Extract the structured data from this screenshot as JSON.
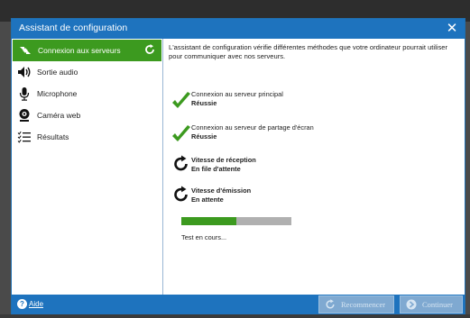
{
  "window": {
    "title": "Assistant de configuration"
  },
  "sidebar": {
    "items": [
      {
        "label": "Connexion aux serveurs",
        "icon": "server-connection-icon",
        "active": true
      },
      {
        "label": "Sortie audio",
        "icon": "speaker-icon"
      },
      {
        "label": "Microphone",
        "icon": "microphone-icon"
      },
      {
        "label": "Caméra web",
        "icon": "webcam-icon"
      },
      {
        "label": "Résultats",
        "icon": "results-list-icon"
      }
    ]
  },
  "main": {
    "intro": "L'assistant de configuration vérifie différentes méthodes que votre ordinateur pourrait utiliser pour communiquer avec nos serveurs.",
    "checks": [
      {
        "name": "Connexion au serveur principal",
        "status": "Réussie",
        "icon": "checkmark-icon"
      },
      {
        "name": "Connexion au serveur de partage d'écran",
        "status": "Réussie",
        "icon": "checkmark-icon"
      },
      {
        "name": "Vitesse de réception",
        "status": "En file d'attente",
        "icon": "refresh-icon"
      },
      {
        "name": "Vitesse d'émission",
        "status": "En attente",
        "icon": "refresh-icon"
      }
    ],
    "progress_fraction": 0.5,
    "progress_text": "Test en cours..."
  },
  "footer": {
    "help_label": "Aide",
    "restart_label": "Recommencer",
    "continue_label": "Continuer"
  },
  "colors": {
    "titlebar": "#1e73be",
    "accent_green": "#3c9a1f",
    "progress_track": "#b0b0b0"
  }
}
